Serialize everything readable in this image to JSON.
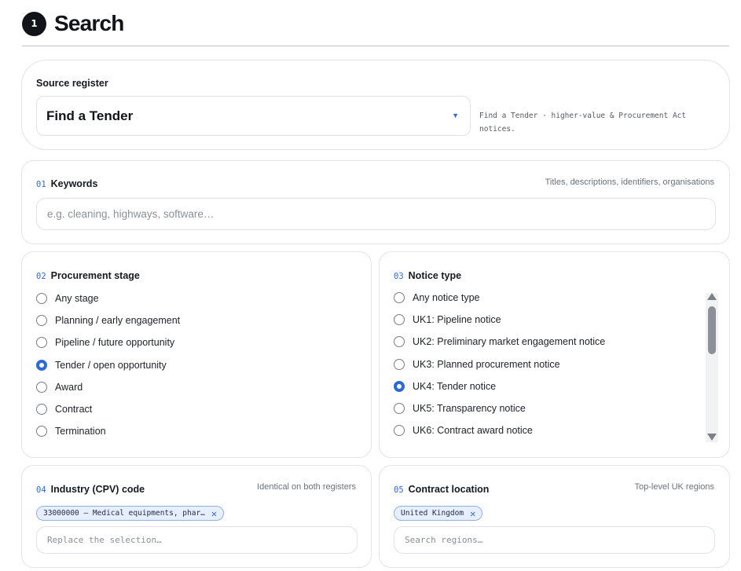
{
  "header": {
    "step": "1",
    "title": "Search"
  },
  "source": {
    "label": "Source register",
    "selected": "Find a Tender",
    "description": "Find a Tender · higher-value & Procurement Act notices."
  },
  "keywords": {
    "num": "01",
    "label": "Keywords",
    "hint": "Titles, descriptions, identifiers, organisations",
    "placeholder": "e.g. cleaning, highways, software…"
  },
  "stage": {
    "num": "02",
    "label": "Procurement stage",
    "options": [
      {
        "label": "Any stage",
        "checked": false
      },
      {
        "label": "Planning / early engagement",
        "checked": false
      },
      {
        "label": "Pipeline / future opportunity",
        "checked": false
      },
      {
        "label": "Tender / open opportunity",
        "checked": true
      },
      {
        "label": "Award",
        "checked": false
      },
      {
        "label": "Contract",
        "checked": false
      },
      {
        "label": "Termination",
        "checked": false
      }
    ]
  },
  "notice": {
    "num": "03",
    "label": "Notice type",
    "options": [
      {
        "label": "Any notice type",
        "checked": false
      },
      {
        "label": "UK1: Pipeline notice",
        "checked": false
      },
      {
        "label": "UK2: Preliminary market engagement notice",
        "checked": false
      },
      {
        "label": "UK3: Planned procurement notice",
        "checked": false
      },
      {
        "label": "UK4: Tender notice",
        "checked": true
      },
      {
        "label": "UK5: Transparency notice",
        "checked": false
      },
      {
        "label": "UK6: Contract award notice",
        "checked": false
      }
    ]
  },
  "cpv": {
    "num": "04",
    "label": "Industry (CPV) code",
    "hint": "Identical on both registers",
    "chip": "33000000 — Medical equipments, phar…",
    "placeholder": "Replace the selection…"
  },
  "location": {
    "num": "05",
    "label": "Contract location",
    "hint": "Top-level UK regions",
    "chip": "United Kingdom",
    "placeholder": "Search regions…"
  },
  "colors": {
    "accent": "#2d6ad8",
    "badge": "#111418",
    "chip_bg": "#e7efff"
  }
}
